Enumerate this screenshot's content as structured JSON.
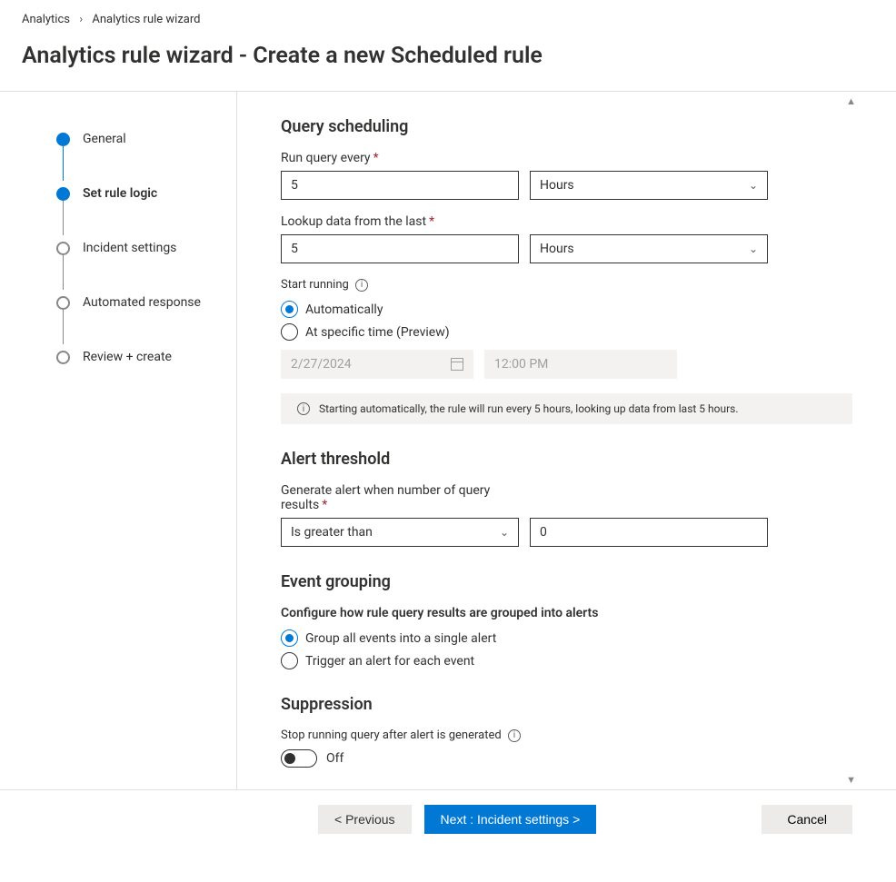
{
  "breadcrumb": {
    "root": "Analytics",
    "current": "Analytics rule wizard"
  },
  "page_title": "Analytics rule wizard - Create a new Scheduled rule",
  "steps": [
    {
      "label": "General",
      "state": "done"
    },
    {
      "label": "Set rule logic",
      "state": "active"
    },
    {
      "label": "Incident settings",
      "state": "pending"
    },
    {
      "label": "Automated response",
      "state": "pending"
    },
    {
      "label": "Review + create",
      "state": "pending"
    }
  ],
  "scheduling": {
    "heading": "Query scheduling",
    "run_every_label": "Run query every",
    "run_every_value": "5",
    "run_every_unit": "Hours",
    "lookup_label": "Lookup data from the last",
    "lookup_value": "5",
    "lookup_unit": "Hours",
    "start_label": "Start running",
    "radio_auto": "Automatically",
    "radio_specific": "At specific time (Preview)",
    "date_value": "2/27/2024",
    "time_value": "12:00 PM",
    "info_text": "Starting automatically, the rule will run every 5 hours, looking up data from last 5 hours."
  },
  "threshold": {
    "heading": "Alert threshold",
    "label": "Generate alert when number of query results",
    "operator": "Is greater than",
    "value": "0"
  },
  "grouping": {
    "heading": "Event grouping",
    "desc": "Configure how rule query results are grouped into alerts",
    "opt_single": "Group all events into a single alert",
    "opt_each": "Trigger an alert for each event"
  },
  "suppression": {
    "heading": "Suppression",
    "label": "Stop running query after alert is generated",
    "state": "Off"
  },
  "footer": {
    "prev": "< Previous",
    "next": "Next : Incident settings >",
    "cancel": "Cancel"
  }
}
